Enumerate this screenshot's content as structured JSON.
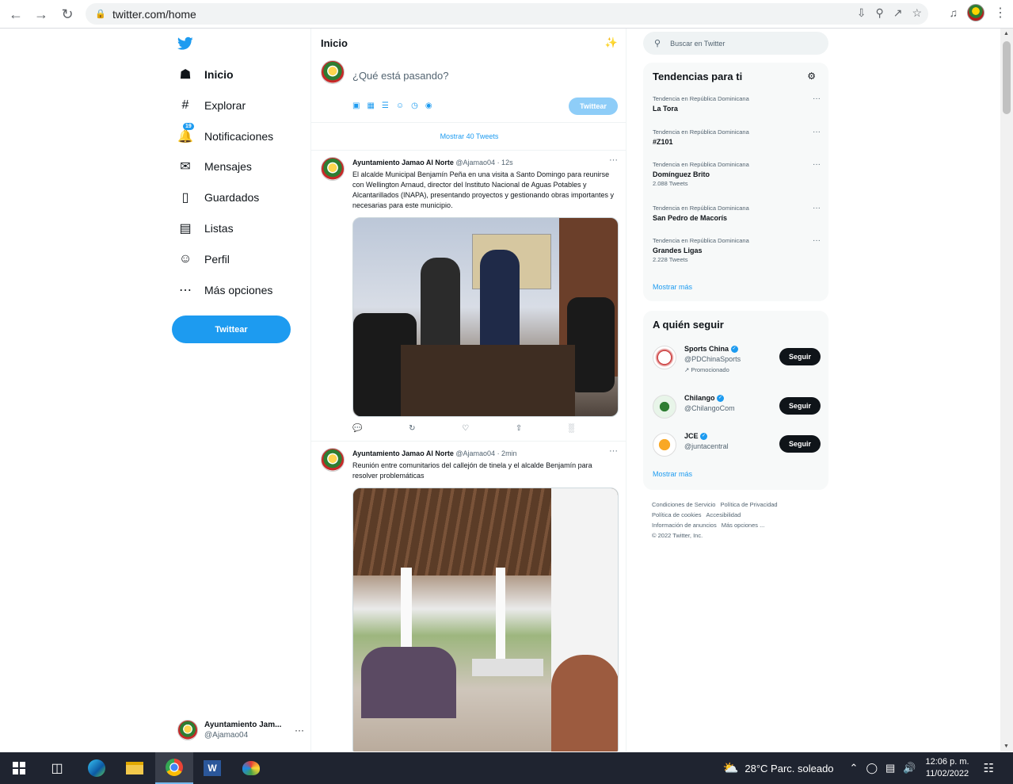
{
  "browser": {
    "url": "twitter.com/home",
    "back_label": "←",
    "forward_label": "→",
    "reload_label": "↻"
  },
  "sidebar": {
    "items": [
      {
        "label": "Inicio",
        "icon": "home-icon",
        "active": true
      },
      {
        "label": "Explorar",
        "icon": "hashtag-icon"
      },
      {
        "label": "Notificaciones",
        "icon": "bell-icon",
        "badge": "19"
      },
      {
        "label": "Mensajes",
        "icon": "mail-icon"
      },
      {
        "label": "Guardados",
        "icon": "bookmark-icon"
      },
      {
        "label": "Listas",
        "icon": "list-icon"
      },
      {
        "label": "Perfil",
        "icon": "user-icon"
      },
      {
        "label": "Más opciones",
        "icon": "more-circle-icon"
      }
    ],
    "tweet_button": "Twittear",
    "account": {
      "name": "Ayuntamiento Jam...",
      "handle": "@Ajamao04"
    }
  },
  "center": {
    "title": "Inicio",
    "composer_placeholder": "¿Qué está pasando?",
    "composer_button": "Twittear",
    "show_new": "Mostrar 40 Tweets",
    "tweets": [
      {
        "name": "Ayuntamiento Jamao Al Norte",
        "handle": "@Ajamao04",
        "time": "· 12s",
        "text": "El alcalde Municipal Benjamín Peña en una visita a Santo Domingo para reunirse con Wellington Arnaud, director del Instituto Nacional de Aguas Potables y Alcantarillados (INAPA),  presentando proyectos y gestionando obras importantes y necesarias para este municipio."
      },
      {
        "name": "Ayuntamiento Jamao Al Norte",
        "handle": "@Ajamao04",
        "time": "· 2min",
        "text": "Reunión entre comunitarios del callejón de tinela y el alcalde Benjamín para resolver problemáticas"
      }
    ]
  },
  "right": {
    "search_placeholder": "Buscar en Twitter",
    "trends_title": "Tendencias para ti",
    "trends": [
      {
        "context": "Tendencia en República Dominicana",
        "topic": "La Tora",
        "count": ""
      },
      {
        "context": "Tendencia en República Dominicana",
        "topic": "#Z101",
        "count": ""
      },
      {
        "context": "Tendencia en República Dominicana",
        "topic": "Domínguez Brito",
        "count": "2.088 Tweets"
      },
      {
        "context": "Tendencia en República Dominicana",
        "topic": "San Pedro de Macorís",
        "count": ""
      },
      {
        "context": "Tendencia en República Dominicana",
        "topic": "Grandes Ligas",
        "count": "2.228 Tweets"
      }
    ],
    "trends_more": "Mostrar más",
    "follow_title": "A quién seguir",
    "follow": [
      {
        "name": "Sports China",
        "handle": "@PDChinaSports",
        "promo": "Promocionado",
        "button": "Seguir"
      },
      {
        "name": "Chilango",
        "handle": "@ChilangoCom",
        "promo": "",
        "button": "Seguir"
      },
      {
        "name": "JCE",
        "handle": "@juntacentral",
        "promo": "",
        "button": "Seguir"
      }
    ],
    "follow_more": "Mostrar más",
    "footer": {
      "l1a": "Condiciones de Servicio",
      "l1b": "Política de Privacidad",
      "l2a": "Política de cookies",
      "l2b": "Accesibilidad",
      "l3a": "Información de anuncios",
      "l3b": "Más opciones ...",
      "copy": "© 2022 Twitter, Inc."
    }
  },
  "taskbar": {
    "weather": "28°C  Parc. soleado",
    "time": "12:06 p. m.",
    "date": "11/02/2022"
  }
}
